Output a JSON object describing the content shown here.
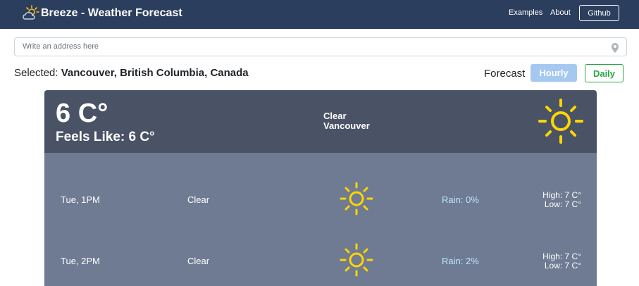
{
  "navbar": {
    "brand": "Breeze - Weather Forecast",
    "links": [
      "Examples",
      "About"
    ],
    "github_label": "Github"
  },
  "search": {
    "placeholder": "Write an address here",
    "value": ""
  },
  "selection": {
    "prefix": "Selected:",
    "location": "Vancouver, British Columbia, Canada"
  },
  "forecast": {
    "label": "Forecast",
    "hourly_label": "Hourly",
    "daily_label": "Daily",
    "active": "Hourly"
  },
  "current": {
    "temp": "6 C°",
    "feels_like": "Feels Like: 6 C°",
    "condition": "Clear",
    "city": "Vancouver",
    "icon": "sun-icon"
  },
  "hourly": [
    {
      "time": "Tue, 1PM",
      "desc": "Clear",
      "icon": "sun-icon",
      "rain": "Rain: 0%",
      "high": "High: 7 C°",
      "low": "Low: 7 C°"
    },
    {
      "time": "Tue, 2PM",
      "desc": "Clear",
      "icon": "sun-icon",
      "rain": "Rain: 2%",
      "high": "High: 7 C°",
      "low": "Low: 7 C°"
    }
  ],
  "colors": {
    "navbar": "#2c3e5d",
    "current_card": "#4a5366",
    "hourly_bg": "#6e7b92",
    "sun": "#ffd500",
    "daily_accent": "#28a745",
    "hourly_btn": "#a5c8f0"
  }
}
